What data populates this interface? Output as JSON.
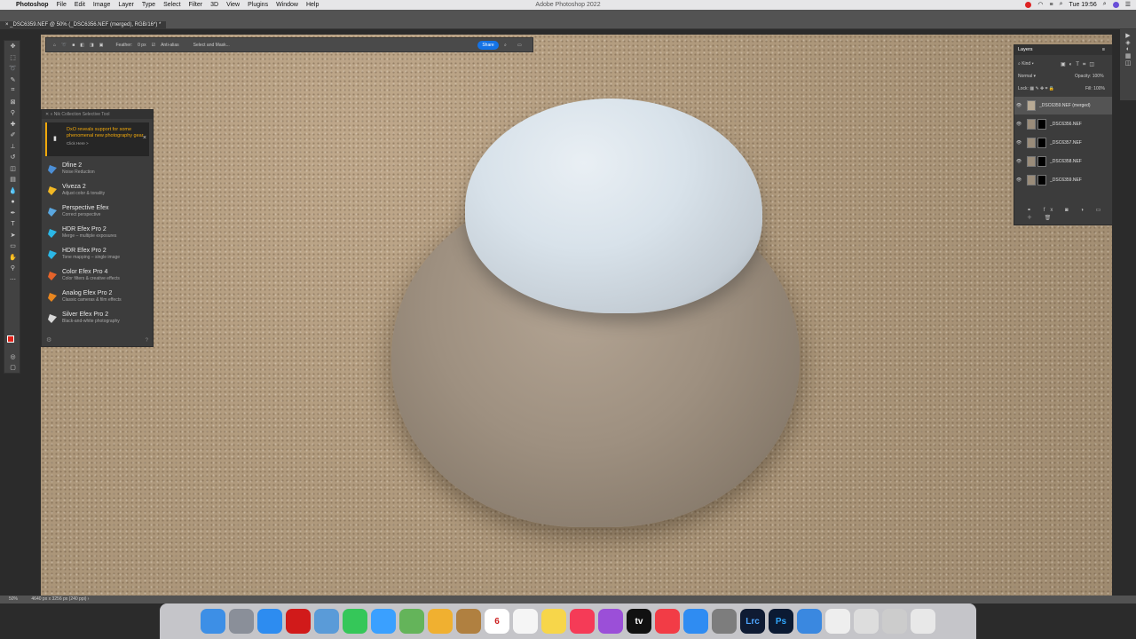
{
  "menubar": {
    "app_name": "Photoshop",
    "menus": [
      "File",
      "Edit",
      "Image",
      "Layer",
      "Type",
      "Select",
      "Filter",
      "3D",
      "View",
      "Plugins",
      "Window",
      "Help"
    ],
    "window_title": "Adobe Photoshop 2022",
    "clock": "Tue 19:56"
  },
  "document": {
    "tab_title": "_DSC6359.NEF @ 50% (_DSC6356.NEF (merged), RGB/16*) *",
    "zoom": "50%",
    "doc_info": "4640 px x 3256 px (240 ppi)"
  },
  "options_bar": {
    "feather_label": "Feather:",
    "feather_value": "0 px",
    "anti_alias_label": "Anti-alias",
    "select_mask_label": "Select and Mask...",
    "share_label": "Share"
  },
  "plugin_panel": {
    "title": "Nik Collection Selective Tool",
    "banner_text": "DxO reveals support for some phenomenal new photography gear.",
    "banner_link": "Click Here >",
    "items": [
      {
        "name": "Dfine 2",
        "desc": "Noise Reduction",
        "color": "#4c8fd6"
      },
      {
        "name": "Viveza 2",
        "desc": "Adjust color & tonality",
        "color": "#f2b824"
      },
      {
        "name": "Perspective Efex",
        "desc": "Correct perspective",
        "color": "#5aa7e0"
      },
      {
        "name": "HDR Efex Pro 2",
        "desc": "Merge – multiple exposures",
        "color": "#2bb7e6"
      },
      {
        "name": "HDR Efex Pro 2",
        "desc": "Tone mapping – single image",
        "color": "#2bb7e6"
      },
      {
        "name": "Color Efex Pro 4",
        "desc": "Color filters & creative effects",
        "color": "#e5632a"
      },
      {
        "name": "Analog Efex Pro 2",
        "desc": "Classic cameras & film effects",
        "color": "#e8861f"
      },
      {
        "name": "Silver Efex Pro 2",
        "desc": "Black-and-white photography",
        "color": "#d8d8d8"
      }
    ]
  },
  "layers_panel": {
    "tab_label": "Layers",
    "kind_label": "Kind",
    "blend_mode": "Normal",
    "opacity_label": "Opacity:",
    "opacity_value": "100%",
    "lock_label": "Lock:",
    "fill_label": "Fill:",
    "fill_value": "100%",
    "layers": [
      {
        "name": "_DSC6359.NEF (merged)",
        "has_mask": false
      },
      {
        "name": "_DSC6356.NEF",
        "has_mask": true
      },
      {
        "name": "_DSC6357.NEF",
        "has_mask": true
      },
      {
        "name": "_DSC6358.NEF",
        "has_mask": true
      },
      {
        "name": "_DSC6359.NEF",
        "has_mask": true
      }
    ]
  },
  "dock": {
    "apps": [
      {
        "icon": "finder-icon",
        "label": "",
        "color": "#3d8fe6"
      },
      {
        "icon": "launchpad-icon",
        "label": "",
        "color": "#8a8f99"
      },
      {
        "icon": "safari-icon",
        "label": "",
        "color": "#2d8cf0"
      },
      {
        "icon": "opera-icon",
        "label": "",
        "color": "#d11a1a"
      },
      {
        "icon": "preview-icon",
        "label": "",
        "color": "#5a9bd8"
      },
      {
        "icon": "facetime-icon",
        "label": "",
        "color": "#35c759"
      },
      {
        "icon": "messages-icon",
        "label": "",
        "color": "#3aa0ff"
      },
      {
        "icon": "maps-icon",
        "label": "",
        "color": "#64b45a"
      },
      {
        "icon": "photos-icon",
        "label": "",
        "color": "#f0b030"
      },
      {
        "icon": "notebook-icon",
        "label": "",
        "color": "#b08040"
      },
      {
        "icon": "calendar-icon",
        "label": "6",
        "color": "#ffffff"
      },
      {
        "icon": "reminders-icon",
        "label": "",
        "color": "#f5f5f5"
      },
      {
        "icon": "notes-icon",
        "label": "",
        "color": "#f7d64a"
      },
      {
        "icon": "music-icon",
        "label": "",
        "color": "#f53b57"
      },
      {
        "icon": "podcasts-icon",
        "label": "",
        "color": "#9b4fd8"
      },
      {
        "icon": "apple-tv-icon",
        "label": "tv",
        "color": "#111111"
      },
      {
        "icon": "news-icon",
        "label": "",
        "color": "#f23c46"
      },
      {
        "icon": "app-store-icon",
        "label": "",
        "color": "#2f8cf2"
      },
      {
        "icon": "system-preferences-icon",
        "label": "",
        "color": "#7d7d7d"
      },
      {
        "icon": "lightroom-classic-icon",
        "label": "Lrc",
        "color": "#0f1b33"
      },
      {
        "icon": "photoshop-icon",
        "label": "Ps",
        "color": "#0b1a33"
      },
      {
        "icon": "dxo-icon",
        "label": "",
        "color": "#3a88e0"
      },
      {
        "icon": "document-icon",
        "label": "",
        "color": "#eeeeee"
      },
      {
        "icon": "finder-window-icon",
        "label": "",
        "color": "#dddddd"
      },
      {
        "icon": "screenshot-icon",
        "label": "",
        "color": "#cccccc"
      },
      {
        "icon": "trash-icon",
        "label": "",
        "color": "#e8e8e8"
      }
    ]
  }
}
